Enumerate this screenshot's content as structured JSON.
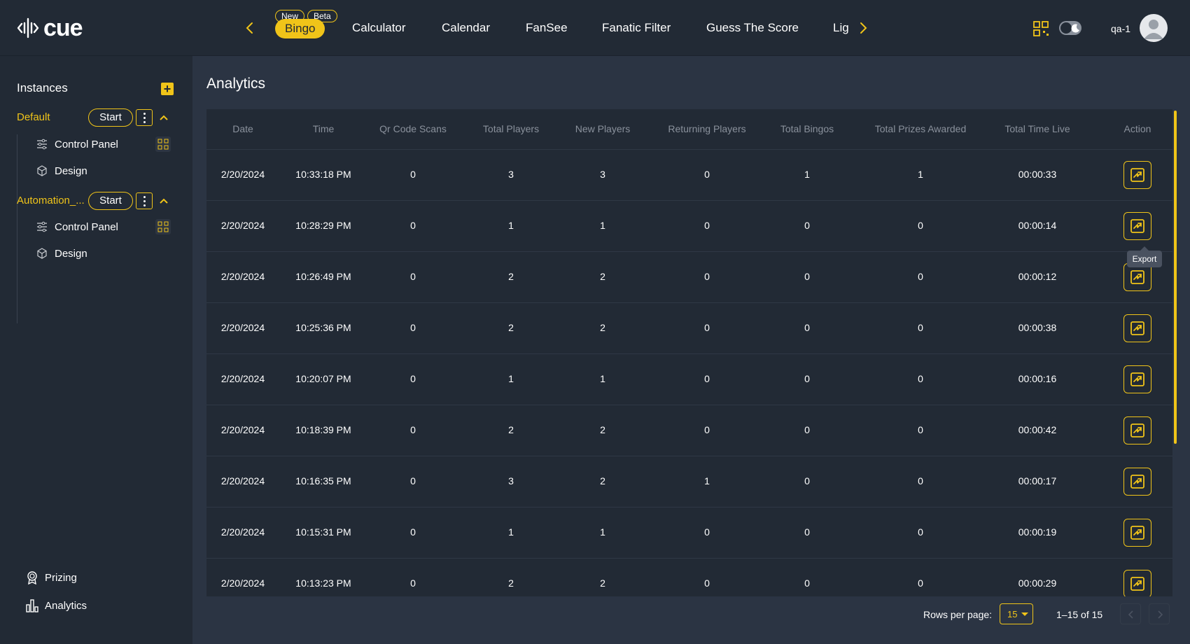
{
  "app": {
    "logo_text": "cue"
  },
  "nav": {
    "tabs": [
      {
        "label": "Bingo",
        "active": true,
        "badges": [
          "New",
          "Beta"
        ]
      },
      {
        "label": "Calculator"
      },
      {
        "label": "Calendar"
      },
      {
        "label": "FanSee"
      },
      {
        "label": "Fanatic Filter"
      },
      {
        "label": "Guess The Score"
      },
      {
        "label": "Lig"
      }
    ]
  },
  "user": {
    "name": "qa-1"
  },
  "sidebar": {
    "title": "Instances",
    "instances": [
      {
        "name": "Default",
        "start_label": "Start",
        "items": [
          {
            "label": "Control Panel"
          },
          {
            "label": "Design"
          }
        ]
      },
      {
        "name": "Automation_...",
        "start_label": "Start",
        "items": [
          {
            "label": "Control Panel"
          },
          {
            "label": "Design"
          }
        ]
      }
    ],
    "bottom": [
      {
        "label": "Prizing"
      },
      {
        "label": "Analytics"
      }
    ]
  },
  "page": {
    "title": "Analytics"
  },
  "table": {
    "columns": [
      "Date",
      "Time",
      "Qr Code Scans",
      "Total Players",
      "New Players",
      "Returning Players",
      "Total Bingos",
      "Total Prizes Awarded",
      "Total Time Live",
      "Action"
    ],
    "rows": [
      [
        "2/20/2024",
        "10:33:18 PM",
        "0",
        "3",
        "3",
        "0",
        "1",
        "1",
        "00:00:33"
      ],
      [
        "2/20/2024",
        "10:28:29 PM",
        "0",
        "1",
        "1",
        "0",
        "0",
        "0",
        "00:00:14"
      ],
      [
        "2/20/2024",
        "10:26:49 PM",
        "0",
        "2",
        "2",
        "0",
        "0",
        "0",
        "00:00:12"
      ],
      [
        "2/20/2024",
        "10:25:36 PM",
        "0",
        "2",
        "2",
        "0",
        "0",
        "0",
        "00:00:38"
      ],
      [
        "2/20/2024",
        "10:20:07 PM",
        "0",
        "1",
        "1",
        "0",
        "0",
        "0",
        "00:00:16"
      ],
      [
        "2/20/2024",
        "10:18:39 PM",
        "0",
        "2",
        "2",
        "0",
        "0",
        "0",
        "00:00:42"
      ],
      [
        "2/20/2024",
        "10:16:35 PM",
        "0",
        "3",
        "2",
        "1",
        "0",
        "0",
        "00:00:17"
      ],
      [
        "2/20/2024",
        "10:15:31 PM",
        "0",
        "1",
        "1",
        "0",
        "0",
        "0",
        "00:00:19"
      ],
      [
        "2/20/2024",
        "10:13:23 PM",
        "0",
        "2",
        "2",
        "0",
        "0",
        "0",
        "00:00:29"
      ]
    ],
    "tooltip": "Export"
  },
  "pagination": {
    "rows_per_page_label": "Rows per page:",
    "rows_per_page_value": "15",
    "range": "1–15 of 15"
  },
  "colors": {
    "accent": "#f0c419",
    "background": "#222a35",
    "panel": "#2b3443"
  }
}
